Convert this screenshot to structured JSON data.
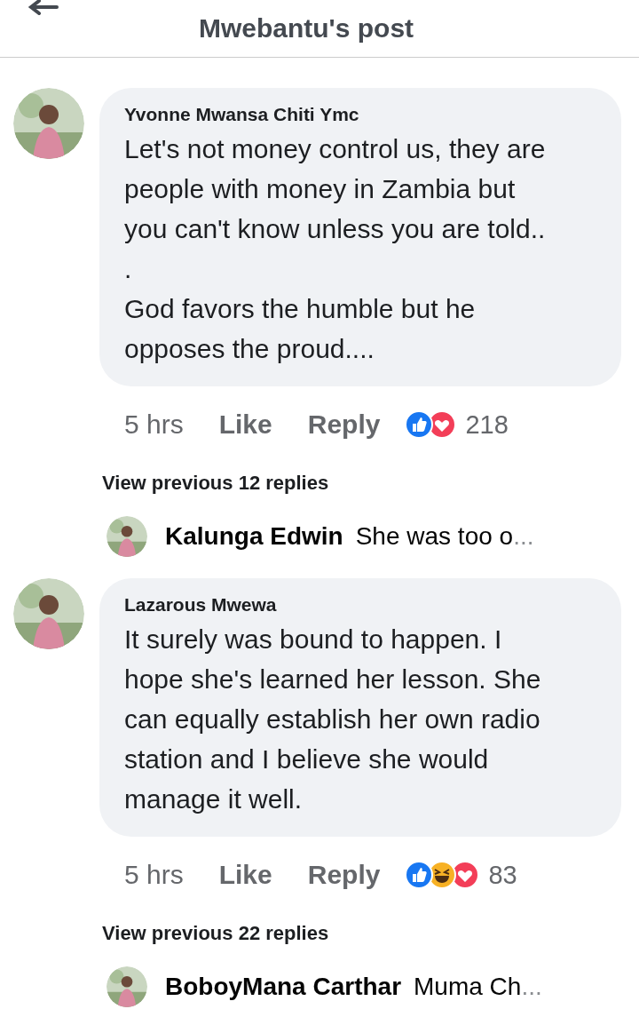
{
  "header": {
    "title": "Mwebantu's post"
  },
  "thread": [
    {
      "kind": "comment",
      "author": "Yvonne Mwansa Chiti Ymc",
      "text": "Let's not money control us, they are\npeople with money in Zambia but\nyou can't know unless you are told..\n.\nGod favors the humble but he\nopposes the proud....",
      "time": "5 hrs",
      "like": "Like",
      "reply": "Reply",
      "reactions": [
        {
          "kind": "like"
        },
        {
          "kind": "love"
        }
      ],
      "count": "218",
      "avatar": {
        "kind": "picture"
      }
    },
    {
      "kind": "more",
      "label": "View previous 12 replies"
    },
    {
      "kind": "reply",
      "author": "Kalunga Edwin",
      "text": "She was too o",
      "ellipsis": "...",
      "avatar": {
        "kind": "picture"
      }
    },
    {
      "kind": "comment",
      "author": "Lazarous Mwewa",
      "text": "It surely was bound to happen. I\nhope she's learned her lesson. She\ncan equally establish her own radio\nstation and I believe she would\nmanage it well.",
      "time": "5 hrs",
      "like": "Like",
      "reply": "Reply",
      "reactions": [
        {
          "kind": "like"
        },
        {
          "kind": "haha"
        },
        {
          "kind": "love"
        }
      ],
      "count": "83",
      "avatar": {
        "kind": "picture"
      }
    },
    {
      "kind": "more",
      "label": "View previous 22 replies"
    },
    {
      "kind": "reply",
      "author": "BoboyMana Carthar",
      "text": "Muma Ch",
      "ellipsis": "...",
      "avatar": {
        "kind": "picture"
      }
    }
  ]
}
